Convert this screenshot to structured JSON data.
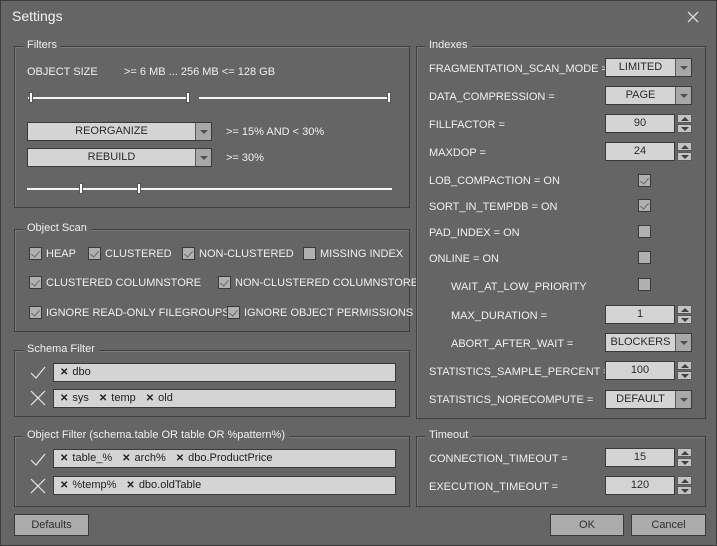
{
  "window": {
    "title": "Settings",
    "close_icon": "close-icon"
  },
  "filters": {
    "title": "Filters",
    "object_size_label": "OBJECT SIZE",
    "object_size_value": ">= 6 MB ... 256 MB <= 128 GB",
    "size_slider_low": {
      "min_handle": "6 MB",
      "max_handle": "256 MB"
    },
    "size_slider_high": {
      "handle": "128 GB"
    },
    "reorganize": {
      "selected": "REORGANIZE",
      "condition": ">= 15% AND < 30%"
    },
    "rebuild": {
      "selected": "REBUILD",
      "condition": ">= 30%"
    },
    "fragmentation_slider": {
      "low_percent": 15,
      "high_percent": 30
    }
  },
  "object_scan": {
    "title": "Object Scan",
    "options": [
      {
        "label": "HEAP",
        "checked": true
      },
      {
        "label": "CLUSTERED",
        "checked": true
      },
      {
        "label": "NON-CLUSTERED",
        "checked": true
      },
      {
        "label": "MISSING INDEX",
        "checked": false
      },
      {
        "label": "CLUSTERED COLUMNSTORE",
        "checked": true
      },
      {
        "label": "NON-CLUSTERED COLUMNSTORE",
        "checked": true
      },
      {
        "label": "IGNORE READ-ONLY FILEGROUPS",
        "checked": true
      },
      {
        "label": "IGNORE OBJECT PERMISSIONS",
        "checked": true
      }
    ]
  },
  "schema_filter": {
    "title": "Schema Filter",
    "include_icon": "check-icon",
    "exclude_icon": "cross-icon",
    "include": [
      "dbo"
    ],
    "exclude": [
      "sys",
      "temp",
      "old"
    ]
  },
  "object_filter": {
    "title": "Object Filter (schema.table OR table OR %pattern%)",
    "include": [
      "table_%",
      "arch%",
      "dbo.ProductPrice"
    ],
    "exclude": [
      "%temp%",
      "dbo.oldTable"
    ]
  },
  "indexes": {
    "title": "Indexes",
    "fragmentation_scan_mode": {
      "label": "FRAGMENTATION_SCAN_MODE =",
      "value": "LIMITED"
    },
    "data_compression": {
      "label": "DATA_COMPRESSION =",
      "value": "PAGE"
    },
    "fillfactor": {
      "label": "FILLFACTOR =",
      "value": "90"
    },
    "maxdop": {
      "label": "MAXDOP =",
      "value": "24"
    },
    "lob_compaction": {
      "label": "LOB_COMPACTION = ON",
      "checked": true
    },
    "sort_in_tempdb": {
      "label": "SORT_IN_TEMPDB = ON",
      "checked": true
    },
    "pad_index": {
      "label": "PAD_INDEX = ON",
      "checked": false
    },
    "online": {
      "label": "ONLINE = ON",
      "checked": false
    },
    "wait_at_low_priority": {
      "label": "WAIT_AT_LOW_PRIORITY",
      "checked": false
    },
    "max_duration": {
      "label": "MAX_DURATION =",
      "value": "1"
    },
    "abort_after_wait": {
      "label": "ABORT_AFTER_WAIT =",
      "value": "BLOCKERS"
    },
    "statistics_sample_percent": {
      "label": "STATISTICS_SAMPLE_PERCENT =",
      "value": "100"
    },
    "statistics_norecompute": {
      "label": "STATISTICS_NORECOMPUTE =",
      "value": "DEFAULT"
    }
  },
  "timeout": {
    "title": "Timeout",
    "connection_timeout": {
      "label": "CONNECTION_TIMEOUT =",
      "value": "15"
    },
    "execution_timeout": {
      "label": "EXECUTION_TIMEOUT =",
      "value": "120"
    }
  },
  "buttons": {
    "defaults": "Defaults",
    "ok": "OK",
    "cancel": "Cancel"
  }
}
